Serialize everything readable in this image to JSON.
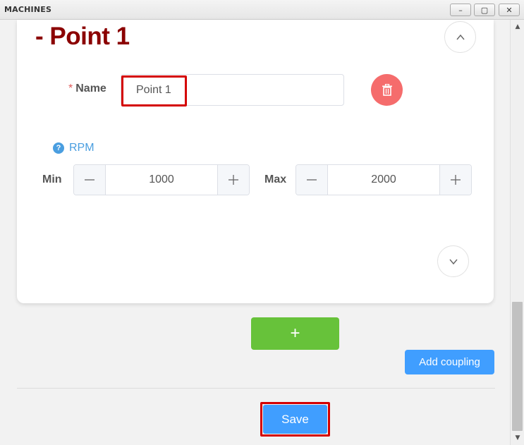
{
  "window": {
    "title": "MACHINES",
    "minimize_symbol": "–",
    "maximize_symbol": "▢",
    "close_symbol": "✕"
  },
  "point": {
    "title": "- Point 1",
    "name_required_mark": "*",
    "name_label": "Name",
    "name_value": "Point 1",
    "rpm_label": "RPM",
    "min_label": "Min",
    "min_value": "1000",
    "max_label": "Max",
    "max_value": "2000"
  },
  "actions": {
    "add_point_symbol": "+",
    "add_coupling_label": "Add coupling",
    "save_label": "Save"
  },
  "icons": {
    "collapse": "chevron-up-icon",
    "expand": "chevron-down-icon",
    "delete": "trash-icon",
    "help": "question-circle-icon",
    "decrement": "minus-icon",
    "increment": "plus-icon"
  },
  "colors": {
    "title_red": "#8b0000",
    "danger": "#f56c6c",
    "success": "#67c23a",
    "primary": "#409eff",
    "highlight": "#d40000"
  }
}
